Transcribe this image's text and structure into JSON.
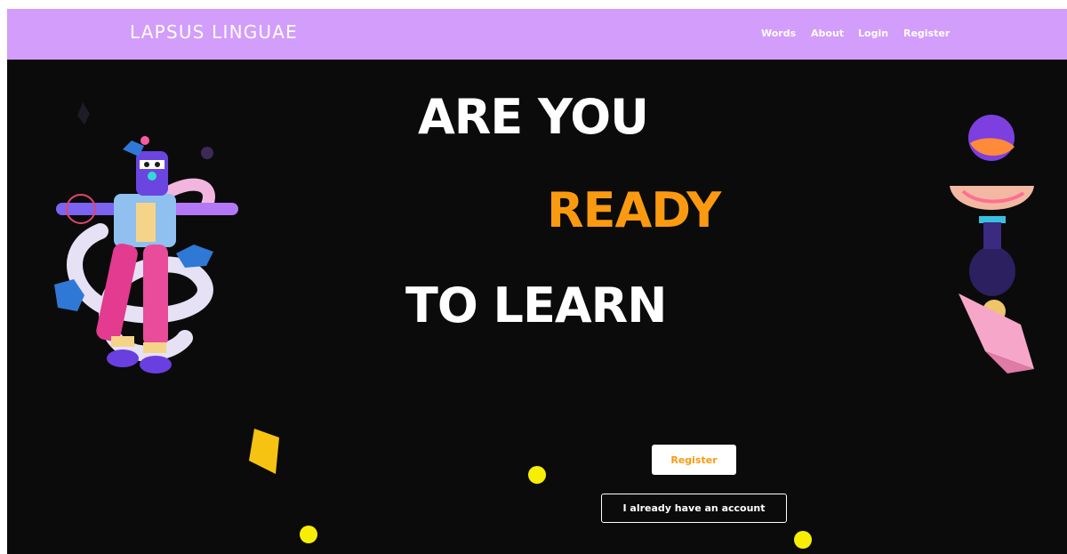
{
  "brand": {
    "name": "LAPSUS LINGUAE"
  },
  "nav": {
    "links": [
      {
        "label": "Words"
      },
      {
        "label": "About"
      },
      {
        "label": "Login"
      },
      {
        "label": "Register"
      }
    ]
  },
  "hero": {
    "line1": "ARE YOU",
    "line2": "READY",
    "line3": "TO LEARN"
  },
  "actions": {
    "register_label": "Register",
    "login_label": "I already have an account"
  },
  "colors": {
    "navbar": "#d39dfb",
    "background": "#0b0b0b",
    "accent": "#fb9a10",
    "dot": "#f7ee06"
  },
  "icons": {
    "left_illustration": "character-3d-illustration",
    "right_illustration": "stacked-shapes-3d-illustration",
    "dots": "yellow-dot-icon",
    "diamond": "yellow-diamond-icon"
  }
}
